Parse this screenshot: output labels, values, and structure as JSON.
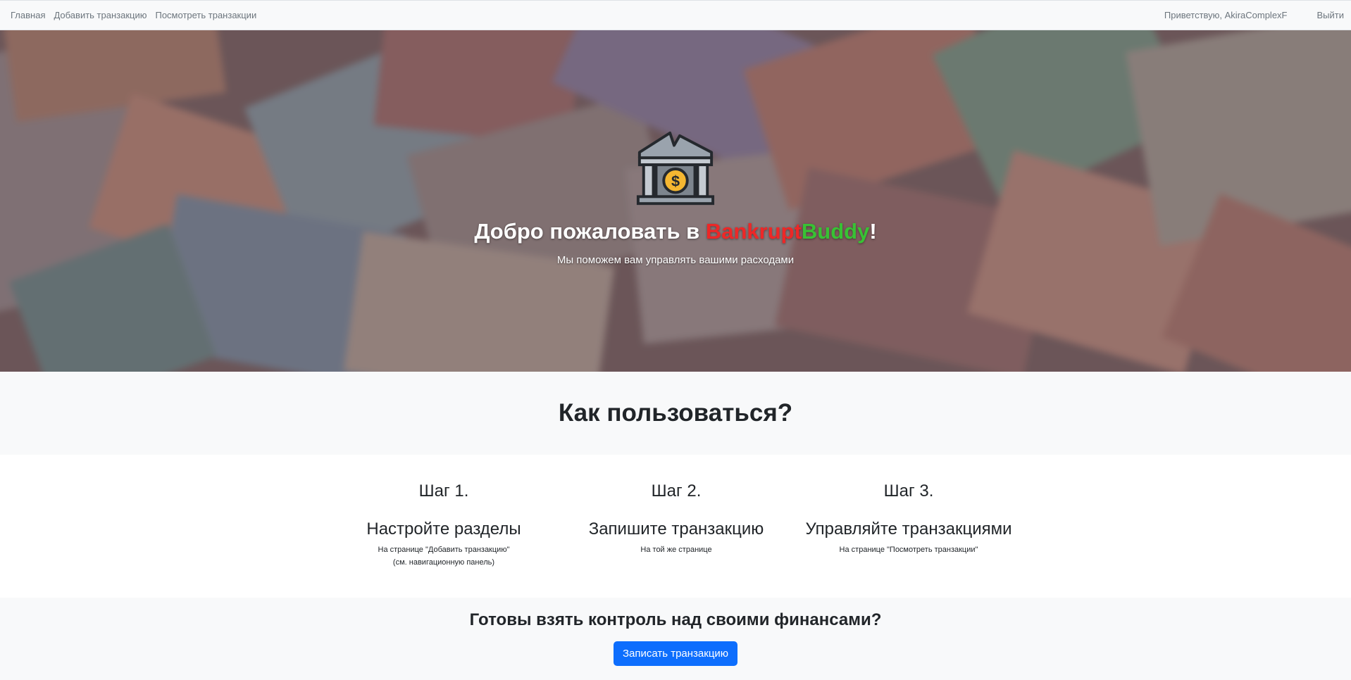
{
  "navbar": {
    "links": [
      "Главная",
      "Добавить транзакцию",
      "Посмотреть транзакции"
    ],
    "greeting": "Приветствую, AkiraComplexF",
    "logout": "Выйти"
  },
  "hero": {
    "logo_icon": "bank-dollar-icon",
    "title_prefix": "Добро пожаловать в ",
    "brand_part1": "Bankrupt",
    "brand_part2": "Buddy",
    "title_suffix": "!",
    "subtitle": "Мы поможем вам управлять вашими расходами",
    "colors": {
      "brand_red": "#ee2727",
      "brand_green": "#38c234"
    }
  },
  "howto": {
    "title": "Как пользоваться?"
  },
  "steps": [
    {
      "number": "Шаг 1.",
      "title": "Настройте разделы",
      "desc_line1": "На странице \"Добавить транзакцию\"",
      "desc_line2": "(см. навигационную панель)"
    },
    {
      "number": "Шаг 2.",
      "title": "Запишите транзакцию",
      "desc_line1": "На той же странице",
      "desc_line2": ""
    },
    {
      "number": "Шаг 3.",
      "title": "Управляйте транзакциями",
      "desc_line1": "На странице \"Посмотреть транзакции\"",
      "desc_line2": ""
    }
  ],
  "cta": {
    "title": "Готовы взять контроль над своими финансами?",
    "button": "Записать транзакцию",
    "button_color": "#0d6efd"
  }
}
